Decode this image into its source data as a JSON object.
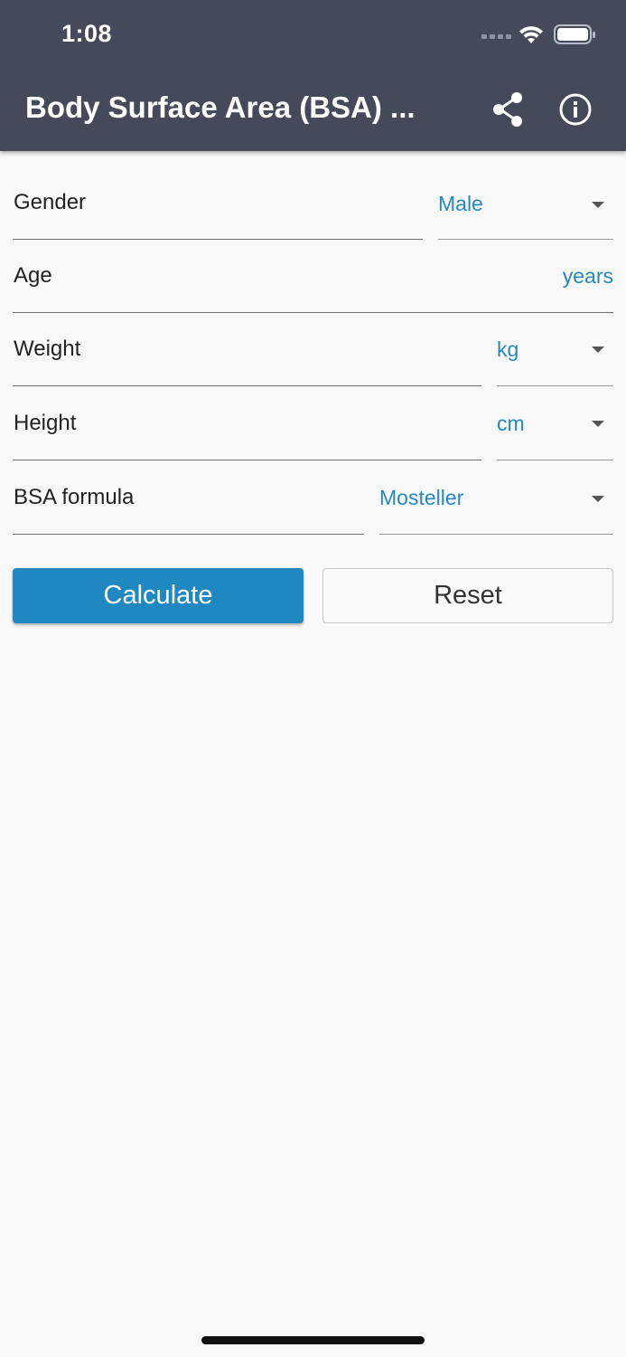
{
  "status_bar": {
    "time": "1:08",
    "icons": [
      "signal-icon",
      "wifi-icon",
      "battery-icon"
    ]
  },
  "app_bar": {
    "title": "Body Surface Area (BSA) ...",
    "actions": [
      "share-icon",
      "info-icon"
    ],
    "background": "#444a59"
  },
  "form": {
    "gender": {
      "label": "Gender",
      "value": "Male"
    },
    "age": {
      "label": "Age",
      "suffix": "years"
    },
    "weight": {
      "label": "Weight",
      "unit": "kg"
    },
    "height": {
      "label": "Height",
      "unit": "cm"
    },
    "formula": {
      "label": "BSA formula",
      "value": "Mosteller"
    }
  },
  "buttons": {
    "calculate": "Calculate",
    "reset": "Reset"
  },
  "colors": {
    "accent": "#2788c0",
    "primary_button": "#2088c1",
    "background": "#f9f9f9"
  }
}
